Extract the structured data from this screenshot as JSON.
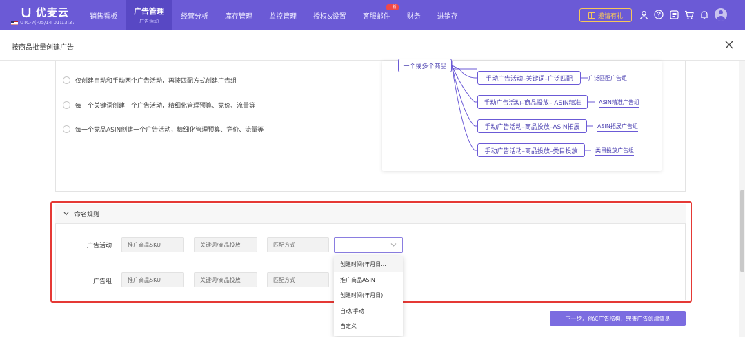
{
  "app": {
    "name": "优麦云",
    "timezone": "UTC-7(-05/14 01:13:37"
  },
  "nav": {
    "items": [
      {
        "label": "销售看板",
        "sub": "",
        "badge": ""
      },
      {
        "label": "广告管理",
        "sub": "广告活动",
        "badge": ""
      },
      {
        "label": "经营分析",
        "sub": "",
        "badge": ""
      },
      {
        "label": "库存管理",
        "sub": "",
        "badge": ""
      },
      {
        "label": "监控管理",
        "sub": "",
        "badge": ""
      },
      {
        "label": "授权&设置",
        "sub": "",
        "badge": ""
      },
      {
        "label": "客服邮件",
        "sub": "",
        "badge": "上新"
      },
      {
        "label": "财务",
        "sub": "",
        "badge": ""
      },
      {
        "label": "进销存",
        "sub": "",
        "badge": ""
      }
    ],
    "invite_label": "邀请有礼",
    "icons": [
      "users-icon",
      "help-icon",
      "list-icon",
      "cart-icon",
      "bell-icon",
      "avatar"
    ]
  },
  "dialog": {
    "title": "按商品批量创建广告"
  },
  "options": [
    {
      "label": "仅创建自动和手动两个广告活动，再按匹配方式创建广告组"
    },
    {
      "label": "每一个关键词创建一个广告活动，精细化管理预算、竞价、流量等"
    },
    {
      "label": "每一个竞品ASIN创建一个广告活动，精细化管理预算、竞价、流量等"
    }
  ],
  "mindmap": {
    "root": "一个或多个商品",
    "branches": [
      {
        "node": "手动广告活动–关键词–广泛匹配",
        "leaf": "广泛匹配广告组"
      },
      {
        "node": "手动广告活动–商品投放– ASIN精准",
        "leaf": "ASIN精准广告组"
      },
      {
        "node": "手动广告活动–商品投放–ASIN拓展",
        "leaf": "ASIN拓展广告组"
      },
      {
        "node": "手动广告活动–商品投放–类目投放",
        "leaf": "类目投放广告组"
      }
    ]
  },
  "naming": {
    "title": "命名规则",
    "rows": [
      {
        "label": "广告活动",
        "fields": [
          "推广商品SKU",
          "关键词/商品投放",
          "匹配方式"
        ]
      },
      {
        "label": "广告组",
        "fields": [
          "推广商品SKU",
          "关键词/商品投放",
          "匹配方式"
        ]
      }
    ],
    "dropdown_options": [
      "创建时间(年月日...",
      "推广商品ASIN",
      "创建时间(年月日)",
      "自动/手动",
      "自定义"
    ]
  },
  "next_button": "下一步，预览广告结构，完善广告创建信息",
  "colors": {
    "brand": "#6b5ad6",
    "highlight": "#e53935",
    "button": "#7b6ce0"
  }
}
